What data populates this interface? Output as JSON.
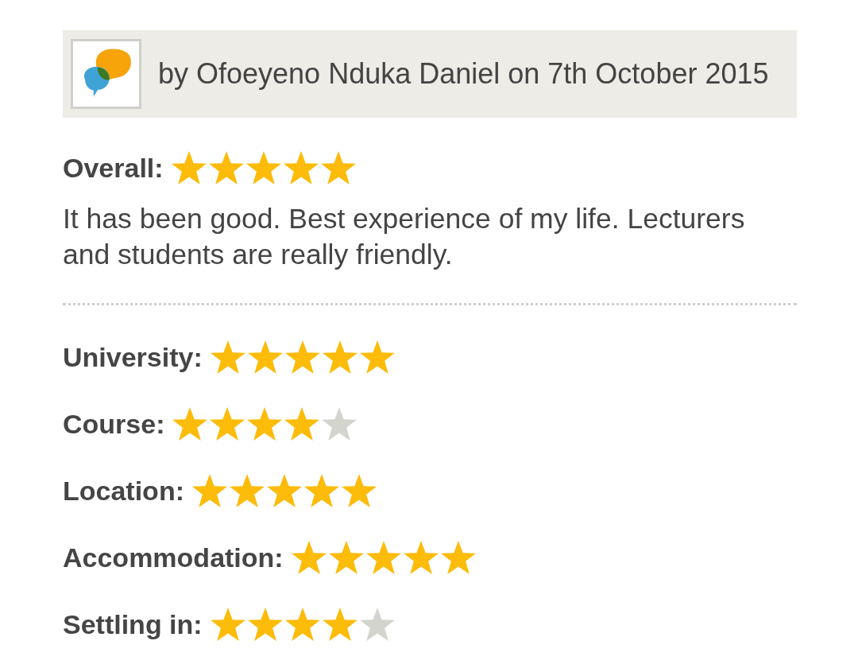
{
  "review": {
    "author_line": "by Ofoeyeno Nduka Daniel on 7th October 2015"
  },
  "overall": {
    "label": "Overall:",
    "stars": 5
  },
  "comment": "It has been good. Best experience of my life. Lecturers and students are really friendly.",
  "ratings": [
    {
      "label": "University:",
      "stars": 5
    },
    {
      "label": "Course:",
      "stars": 4
    },
    {
      "label": "Location:",
      "stars": 5
    },
    {
      "label": "Accommodation:",
      "stars": 5
    },
    {
      "label": "Settling in:",
      "stars": 4
    }
  ]
}
